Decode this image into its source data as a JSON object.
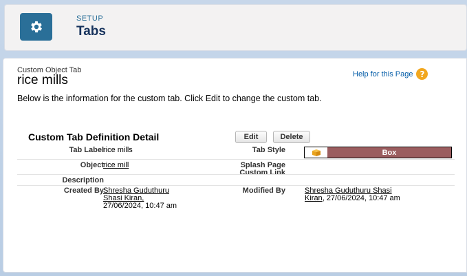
{
  "header": {
    "eyebrow": "SETUP",
    "title": "Tabs",
    "icon": "gear-icon",
    "accent": "#2a6f98"
  },
  "record": {
    "type_label": "Custom Object Tab",
    "title": "rice mills",
    "help_link": "Help for this Page",
    "help_icon": "?",
    "intro": "Below is the information for the custom tab. Click Edit to change the custom tab."
  },
  "detail": {
    "section_title": "Custom Tab Definition Detail",
    "edit_label": "Edit",
    "delete_label": "Delete",
    "fields": {
      "tab_label": {
        "label": "Tab Label",
        "value": "rice mills"
      },
      "tab_style": {
        "label": "Tab Style",
        "value": "Box",
        "swatch_color": "#9b5d5f"
      },
      "object": {
        "label": "Object",
        "value": "rice mill"
      },
      "splash_page": {
        "label_line1": "Splash Page",
        "label_line2": "Custom Link",
        "value": ""
      },
      "description": {
        "label": "Description",
        "value": ""
      },
      "created_by": {
        "label": "Created By",
        "user": "Shresha Guduthuru Shasi Kiran",
        "user_line1": "Shresha Guduthuru",
        "user_line2": "Shasi Kiran",
        "date": "27/06/2024, 10:47 am"
      },
      "modified_by": {
        "label": "Modified By",
        "user": "Shresha Guduthuru Shasi Kiran",
        "user_line1": "Shresha Guduthuru Shasi",
        "user_line2": "Kiran",
        "date": "27/06/2024, 10:47 am"
      }
    }
  }
}
